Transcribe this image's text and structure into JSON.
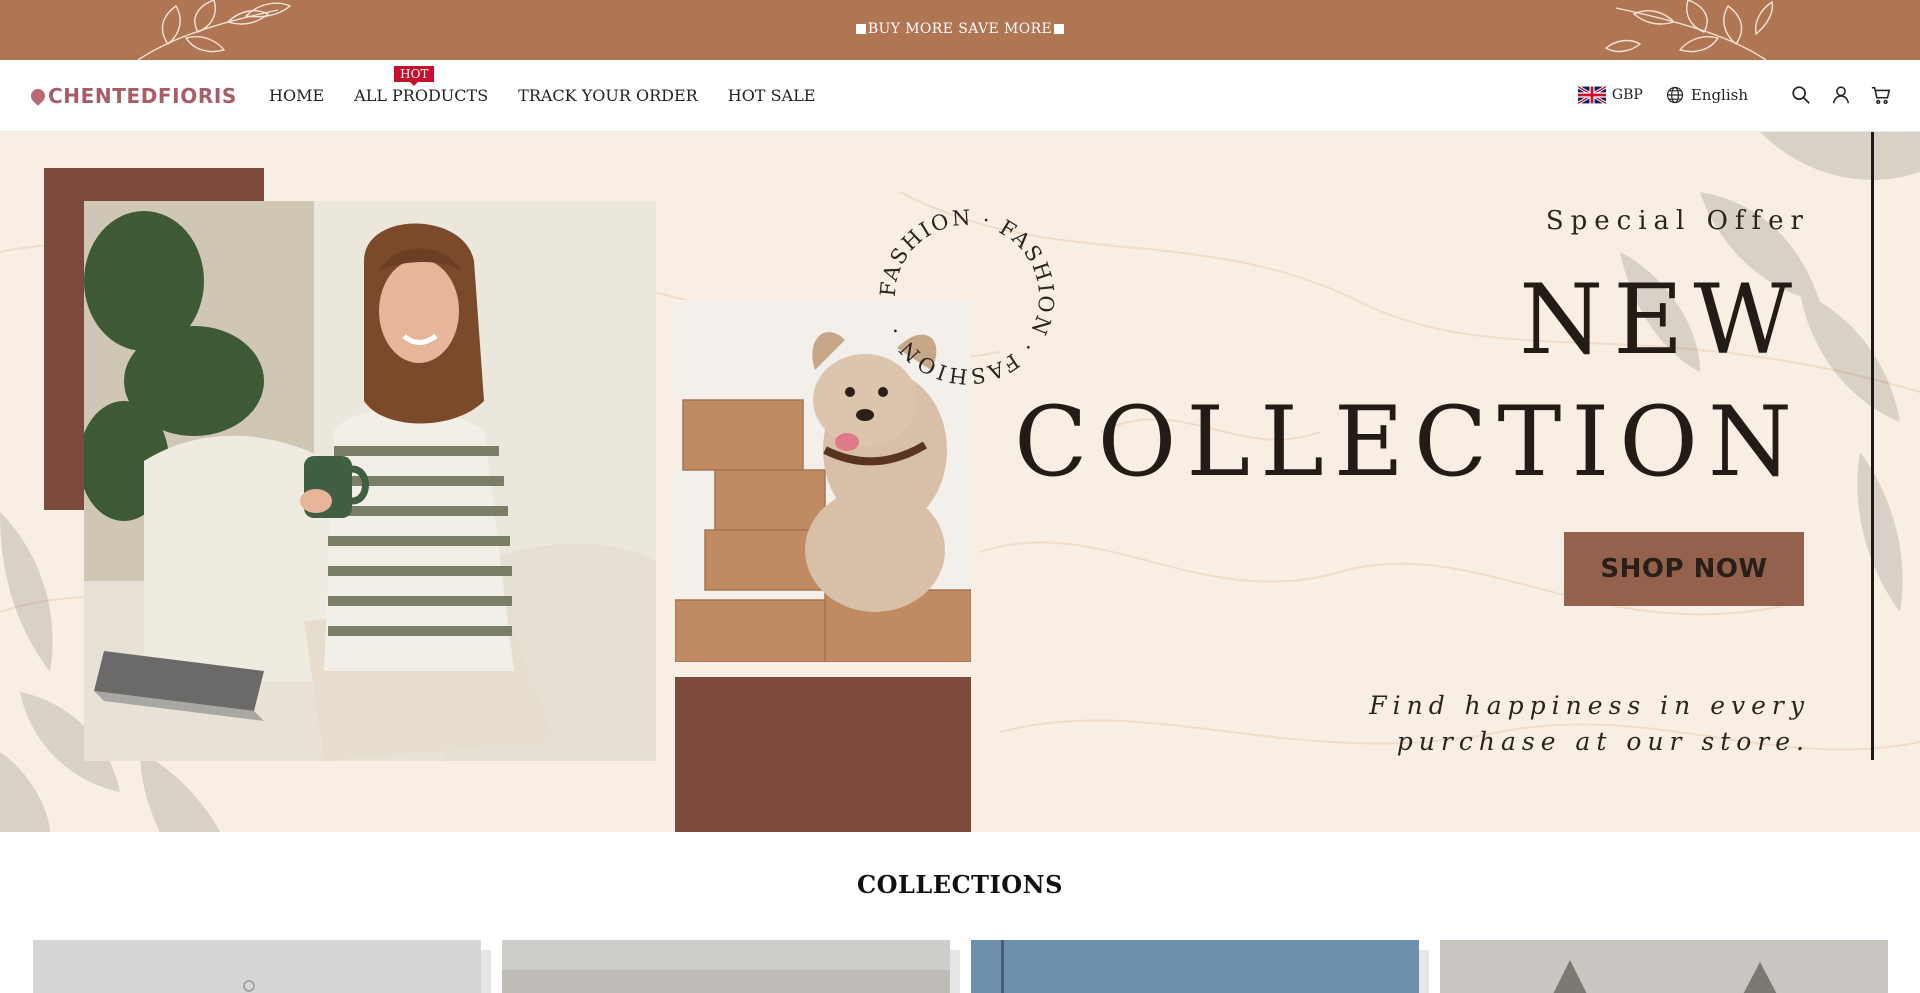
{
  "announcement": {
    "text": "BUY MORE SAVE MORE"
  },
  "header": {
    "logo": "CHENTEDFIORIS",
    "nav": [
      {
        "label": "HOME"
      },
      {
        "label": "ALL PRODUCTS",
        "badge": "HOT"
      },
      {
        "label": "TRACK YOUR ORDER"
      },
      {
        "label": "HOT SALE"
      }
    ],
    "currency": "GBP",
    "language": "English",
    "icons": [
      "search-icon",
      "account-icon",
      "cart-icon",
      "globe-icon",
      "uk-flag-icon"
    ]
  },
  "hero": {
    "ring_text": "FASHION · FASHION · FASHION ·",
    "special": "Special Offer",
    "headline_1": "NEW",
    "headline_2": "COLLECTION",
    "cta": "SHOP NOW",
    "tagline_1": "Find happiness in every",
    "tagline_2": "purchase at our store."
  },
  "collections": {
    "title": "COLLECTIONS"
  },
  "colors": {
    "announcement_bg": "#b07552",
    "brand": "#a85c66",
    "hero_accent": "#7c4a3c",
    "button": "#94614d",
    "badge": "#c8102e"
  }
}
